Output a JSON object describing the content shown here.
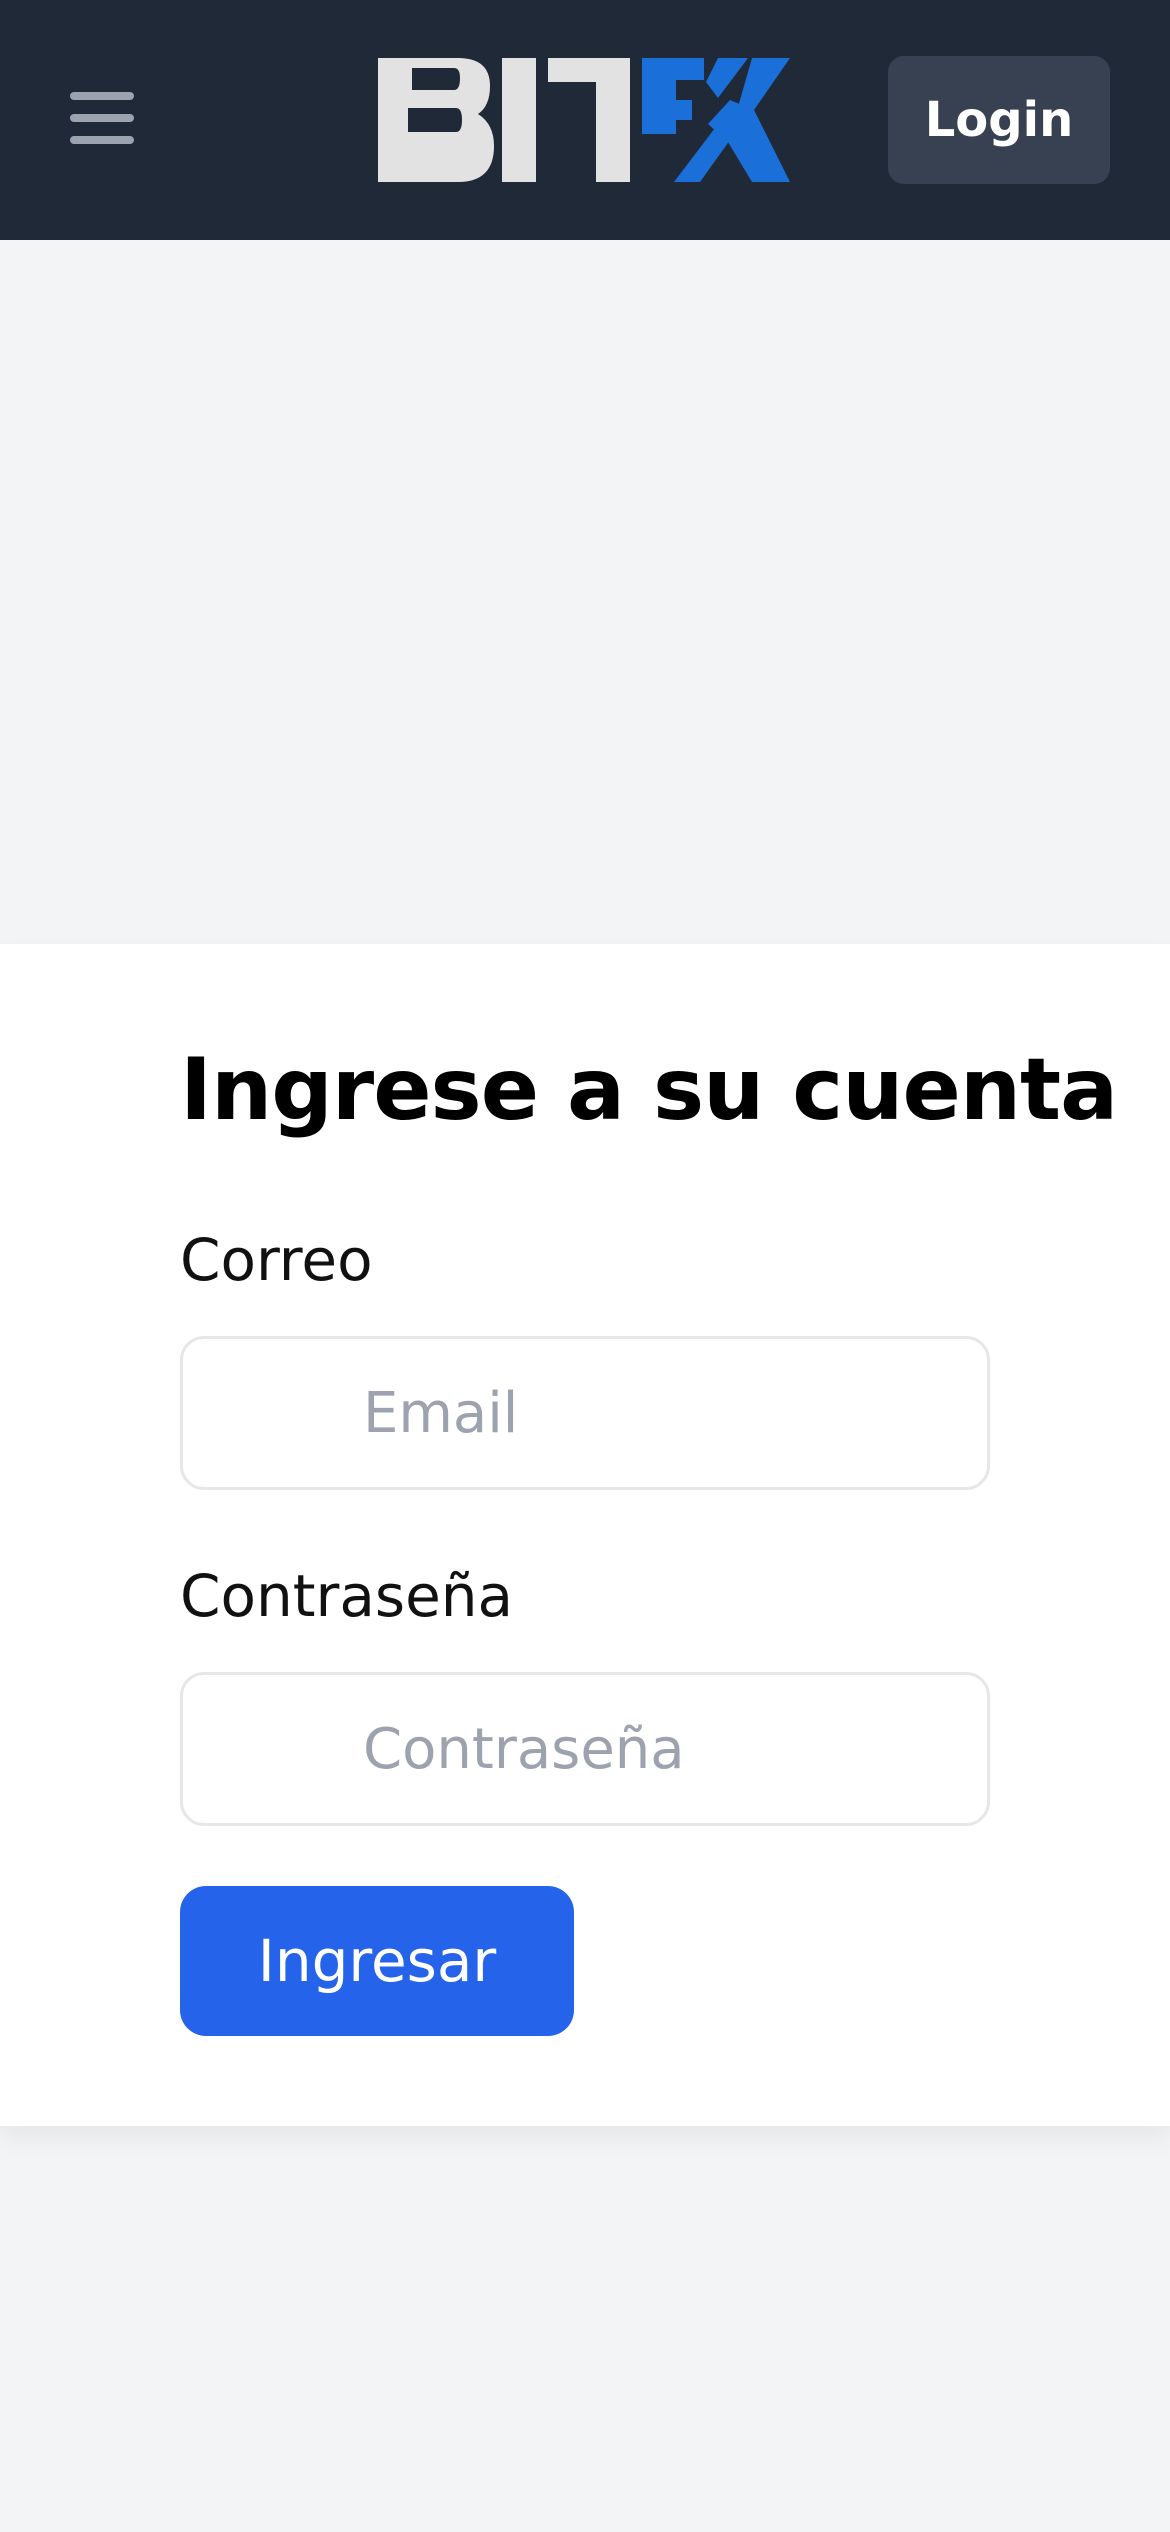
{
  "header": {
    "logo_text": "BITFX",
    "login_label": "Login",
    "icons": {
      "menu": "hamburger-menu-icon"
    },
    "colors": {
      "background": "#1f2937",
      "logo_gray": "#e2e2e2",
      "logo_blue": "#1b6fd8",
      "login_button": "#374151"
    }
  },
  "form": {
    "title": "Ingrese a su cuenta",
    "email_label": "Correo",
    "email_placeholder": "Email",
    "password_label": "Contraseña",
    "password_placeholder": "Contraseña",
    "submit_label": "Ingresar",
    "colors": {
      "submit_button": "#2563eb"
    }
  }
}
